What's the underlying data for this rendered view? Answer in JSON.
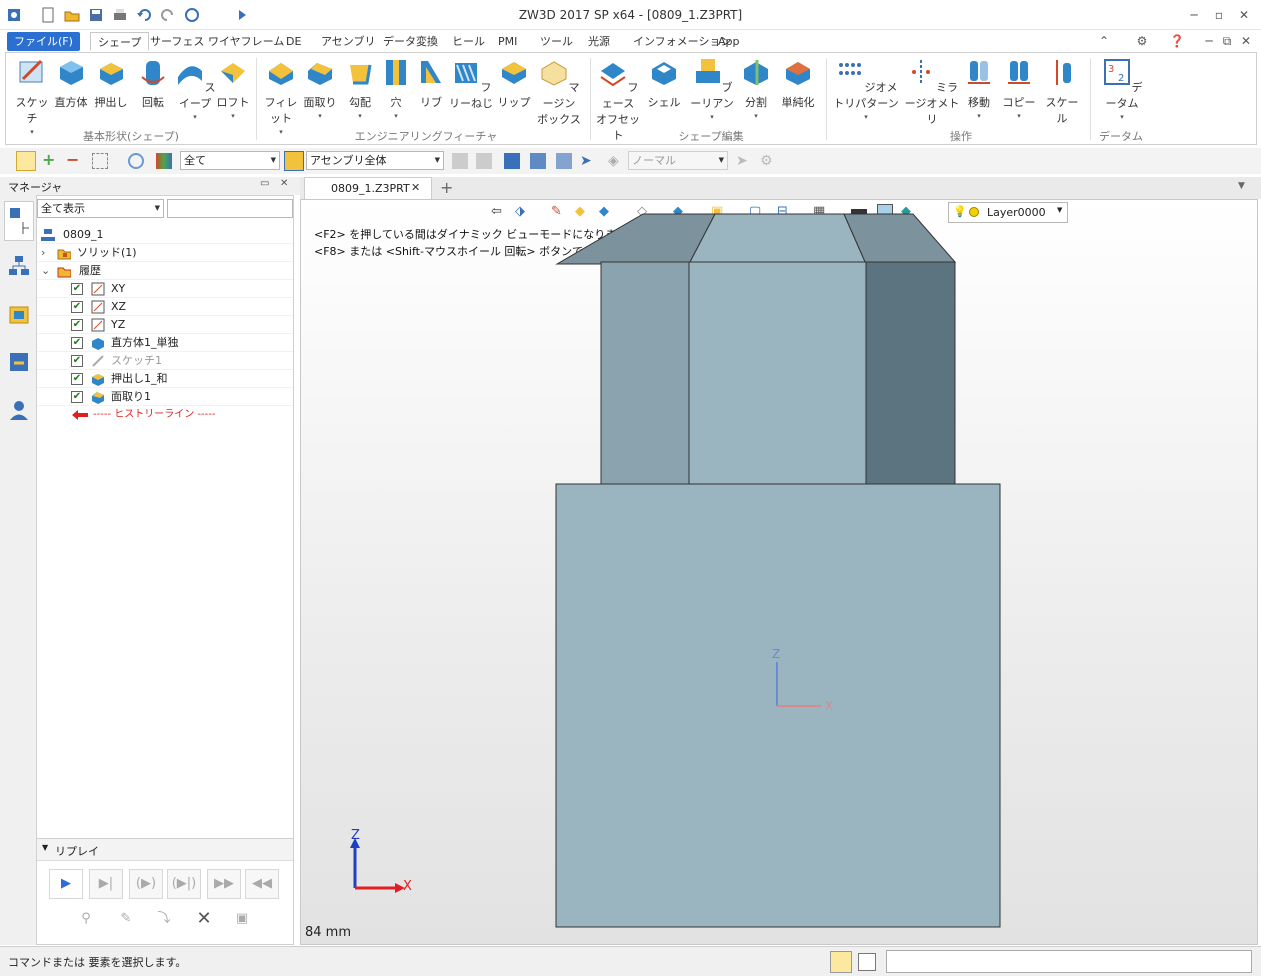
{
  "window": {
    "title": "ZW3D 2017 SP x64 - [0809_1.Z3PRT]"
  },
  "menu": {
    "tabs": [
      "ファイル(F)",
      "シェープ",
      "サーフェス",
      "ワイヤフレーム",
      "DE",
      "アセンブリ",
      "データ変換",
      "ヒール",
      "PMI",
      "ツール",
      "光源",
      "インフォメーション",
      "App"
    ]
  },
  "ribbon": {
    "basic": [
      "スケッチ",
      "直方体",
      "押出し",
      "回転",
      "スイープ",
      "ロフト"
    ],
    "basic_group": "基本形状(シェープ)",
    "eng": [
      "フィレット",
      "面取り",
      "勾配",
      "穴",
      "リブ",
      "フリーねじ",
      "リップ",
      "マージン",
      "ボックス"
    ],
    "eng_group": "エンジニアリングフィーチャ",
    "edit": [
      "フェース",
      "オフセット",
      "シェル",
      "ブーリアン",
      "分割",
      "単純化"
    ],
    "edit_group": "シェープ編集",
    "ops": [
      "ジオメトリパターン",
      "ミラージオメトリ",
      "移動",
      "コピー",
      "スケール"
    ],
    "ops_group": "操作",
    "datum": [
      "データム"
    ],
    "datum_group": "データム"
  },
  "toolbar": {
    "filter": "全て",
    "scope": "アセンブリ全体",
    "mode": "ノーマル"
  },
  "manager": {
    "title": "マネージャ",
    "filter": "全て表示",
    "root": "0809_1",
    "solid": "ソリッド(1)",
    "history": "履歴",
    "items": [
      "XY",
      "XZ",
      "YZ",
      "直方体1_単独",
      "スケッチ1",
      "押出し1_和",
      "面取り1"
    ],
    "history_line": "----- ヒストリーライン -----"
  },
  "replay": {
    "title": "リプレイ"
  },
  "doc": {
    "tab": "0809_1.Z3PRT"
  },
  "view": {
    "hint1": "<F2> を押している間はダイナミック ビューモードになります。",
    "hint2": "<F8> または <Shift-マウスホイール 回転> ボタンで 次に 有効な要素ピックを表示します。",
    "layer": "Layer0000",
    "scale": "84 mm",
    "axis_x": "X",
    "axis_z": "Z"
  },
  "status": {
    "text": "コマンドまたは 要素を選択します。"
  },
  "colors": {
    "accent": "#2b6fd0",
    "model_face": "#9ab4c0",
    "model_dark": "#5c7380",
    "model_top": "#7c939e"
  }
}
